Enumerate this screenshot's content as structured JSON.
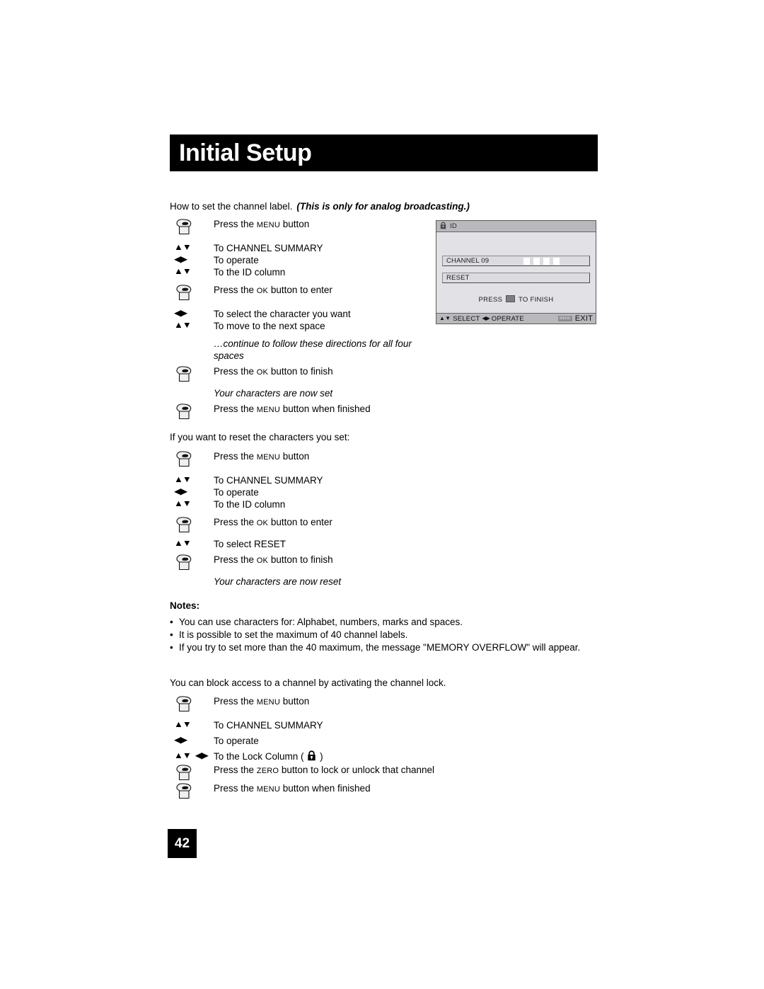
{
  "header": {
    "title": "Initial Setup"
  },
  "page_number": "42",
  "intro": {
    "text": "How to set the channel label.",
    "emphasis": "(This is only for analog broadcasting.)"
  },
  "sections": {
    "set_label_steps": [
      {
        "glyph": "hand-press-icon",
        "text_pre": "Press the ",
        "smallcap": "MENU",
        "text_post": " button",
        "spacing": "tight"
      },
      {
        "glyph": "up-down-arrows-icon",
        "text_pre": "To CHANNEL SUMMARY",
        "smallcap": "",
        "text_post": "",
        "spacing": "gap"
      },
      {
        "glyph": "left-right-arrows-icon",
        "text_pre": "To operate",
        "smallcap": "",
        "text_post": "",
        "spacing": "tight"
      },
      {
        "glyph": "up-down-arrows-icon",
        "text_pre": "To the ID column",
        "smallcap": "",
        "text_post": "",
        "spacing": "tight"
      },
      {
        "glyph": "hand-press-icon",
        "text_pre": "Press the ",
        "smallcap": "OK",
        "text_post": " button to enter",
        "spacing": "gap"
      },
      {
        "glyph": "left-right-arrows-icon",
        "text_pre": "To select the character you want",
        "smallcap": "",
        "text_post": "",
        "spacing": "gap"
      },
      {
        "glyph": "up-down-arrows-icon",
        "text_pre": "To move to the next space",
        "smallcap": "",
        "text_post": "",
        "spacing": "tight"
      }
    ],
    "continue_note_line1": "…continue to follow these directions for all four",
    "continue_note_line2": "spaces",
    "finish_step": {
      "glyph": "hand-press-icon",
      "text_pre": "Press the ",
      "smallcap": "OK",
      "text_post": " button to finish"
    },
    "characters_set_note": "Your characters are now set",
    "menu_finished_step": {
      "glyph": "hand-press-icon",
      "text_pre": "Press the ",
      "smallcap": "MENU",
      "text_post": " button when finished"
    },
    "reset_intro": "If you want to reset the characters you set:",
    "reset_steps": [
      {
        "glyph": "hand-press-icon",
        "text_pre": "Press the ",
        "smallcap": "MENU",
        "text_post": " button",
        "spacing": "tight"
      },
      {
        "glyph": "up-down-arrows-icon",
        "text_pre": "To CHANNEL SUMMARY",
        "smallcap": "",
        "text_post": "",
        "spacing": "gap"
      },
      {
        "glyph": "left-right-arrows-icon",
        "text_pre": "To operate",
        "smallcap": "",
        "text_post": "",
        "spacing": "tight"
      },
      {
        "glyph": "up-down-arrows-icon",
        "text_pre": "To the ID column",
        "smallcap": "",
        "text_post": "",
        "spacing": "tight"
      },
      {
        "glyph": "hand-press-icon",
        "text_pre": "Press the ",
        "smallcap": "OK",
        "text_post": " button to enter",
        "spacing": "gap"
      },
      {
        "glyph": "up-down-arrows-icon",
        "text_pre": "To select RESET",
        "smallcap": "",
        "text_post": "",
        "spacing": "gap-s"
      },
      {
        "glyph": "hand-press-icon",
        "text_pre": "Press the ",
        "smallcap": "OK",
        "text_post": " button to finish",
        "spacing": "gap-s"
      }
    ],
    "characters_reset_note": "Your characters are now reset"
  },
  "notes": {
    "title": "Notes:",
    "bullet_char": "•",
    "items": [
      "You can use characters for: Alphabet, numbers, marks and spaces.",
      "It is possible to set the maximum of 40 channel labels.",
      "If you try to set more than the 40 maximum, the message \"MEMORY OVERFLOW\" will appear."
    ]
  },
  "channel_lock": {
    "intro": "You can block access to a channel by activating the channel lock.",
    "steps": [
      {
        "glyph": "hand-press-icon",
        "text_pre": "Press the ",
        "smallcap": "MENU",
        "text_post": " button",
        "spacing": "tight"
      },
      {
        "glyph": "up-down-arrows-icon",
        "text_pre": "To CHANNEL SUMMARY",
        "smallcap": "",
        "text_post": "",
        "spacing": "gap"
      },
      {
        "glyph": "left-right-arrows-icon",
        "text_pre": "To operate",
        "smallcap": "",
        "text_post": "",
        "spacing": "gap-s"
      }
    ],
    "lock_column_step": {
      "glyph": "up-down-left-right-arrows-icon",
      "text_pre": "To the Lock Column ( ",
      "text_post": " )"
    },
    "zero_step": {
      "glyph": "hand-press-icon",
      "text_pre": "Press the ",
      "smallcap": "ZERO",
      "text_post": " button to lock or unlock that channel"
    },
    "menu_step": {
      "glyph": "hand-press-icon",
      "text_pre": "Press the ",
      "smallcap": "MENU",
      "text_post": " button when finished"
    }
  },
  "osd": {
    "header_title": "ID",
    "header_icon": "lock-icon",
    "rows": [
      {
        "label": "CHANNEL 09",
        "char_boxes": 4
      },
      {
        "label": "RESET",
        "char_boxes": 0
      }
    ],
    "finish_text_pre": "PRESS ",
    "finish_text_post": " TO FINISH",
    "footer": {
      "select_label": "SELECT",
      "operate_label": "OPERATE",
      "menu_chip": "MENU",
      "exit_label": "EXIT"
    }
  },
  "colors": {
    "banner_bg": "#000000",
    "banner_text": "#ffffff",
    "osd_panel_bg": "#e2e2e6",
    "osd_bar_bg": "#b9b9bd",
    "osd_row_bg": "#dcdce0"
  }
}
